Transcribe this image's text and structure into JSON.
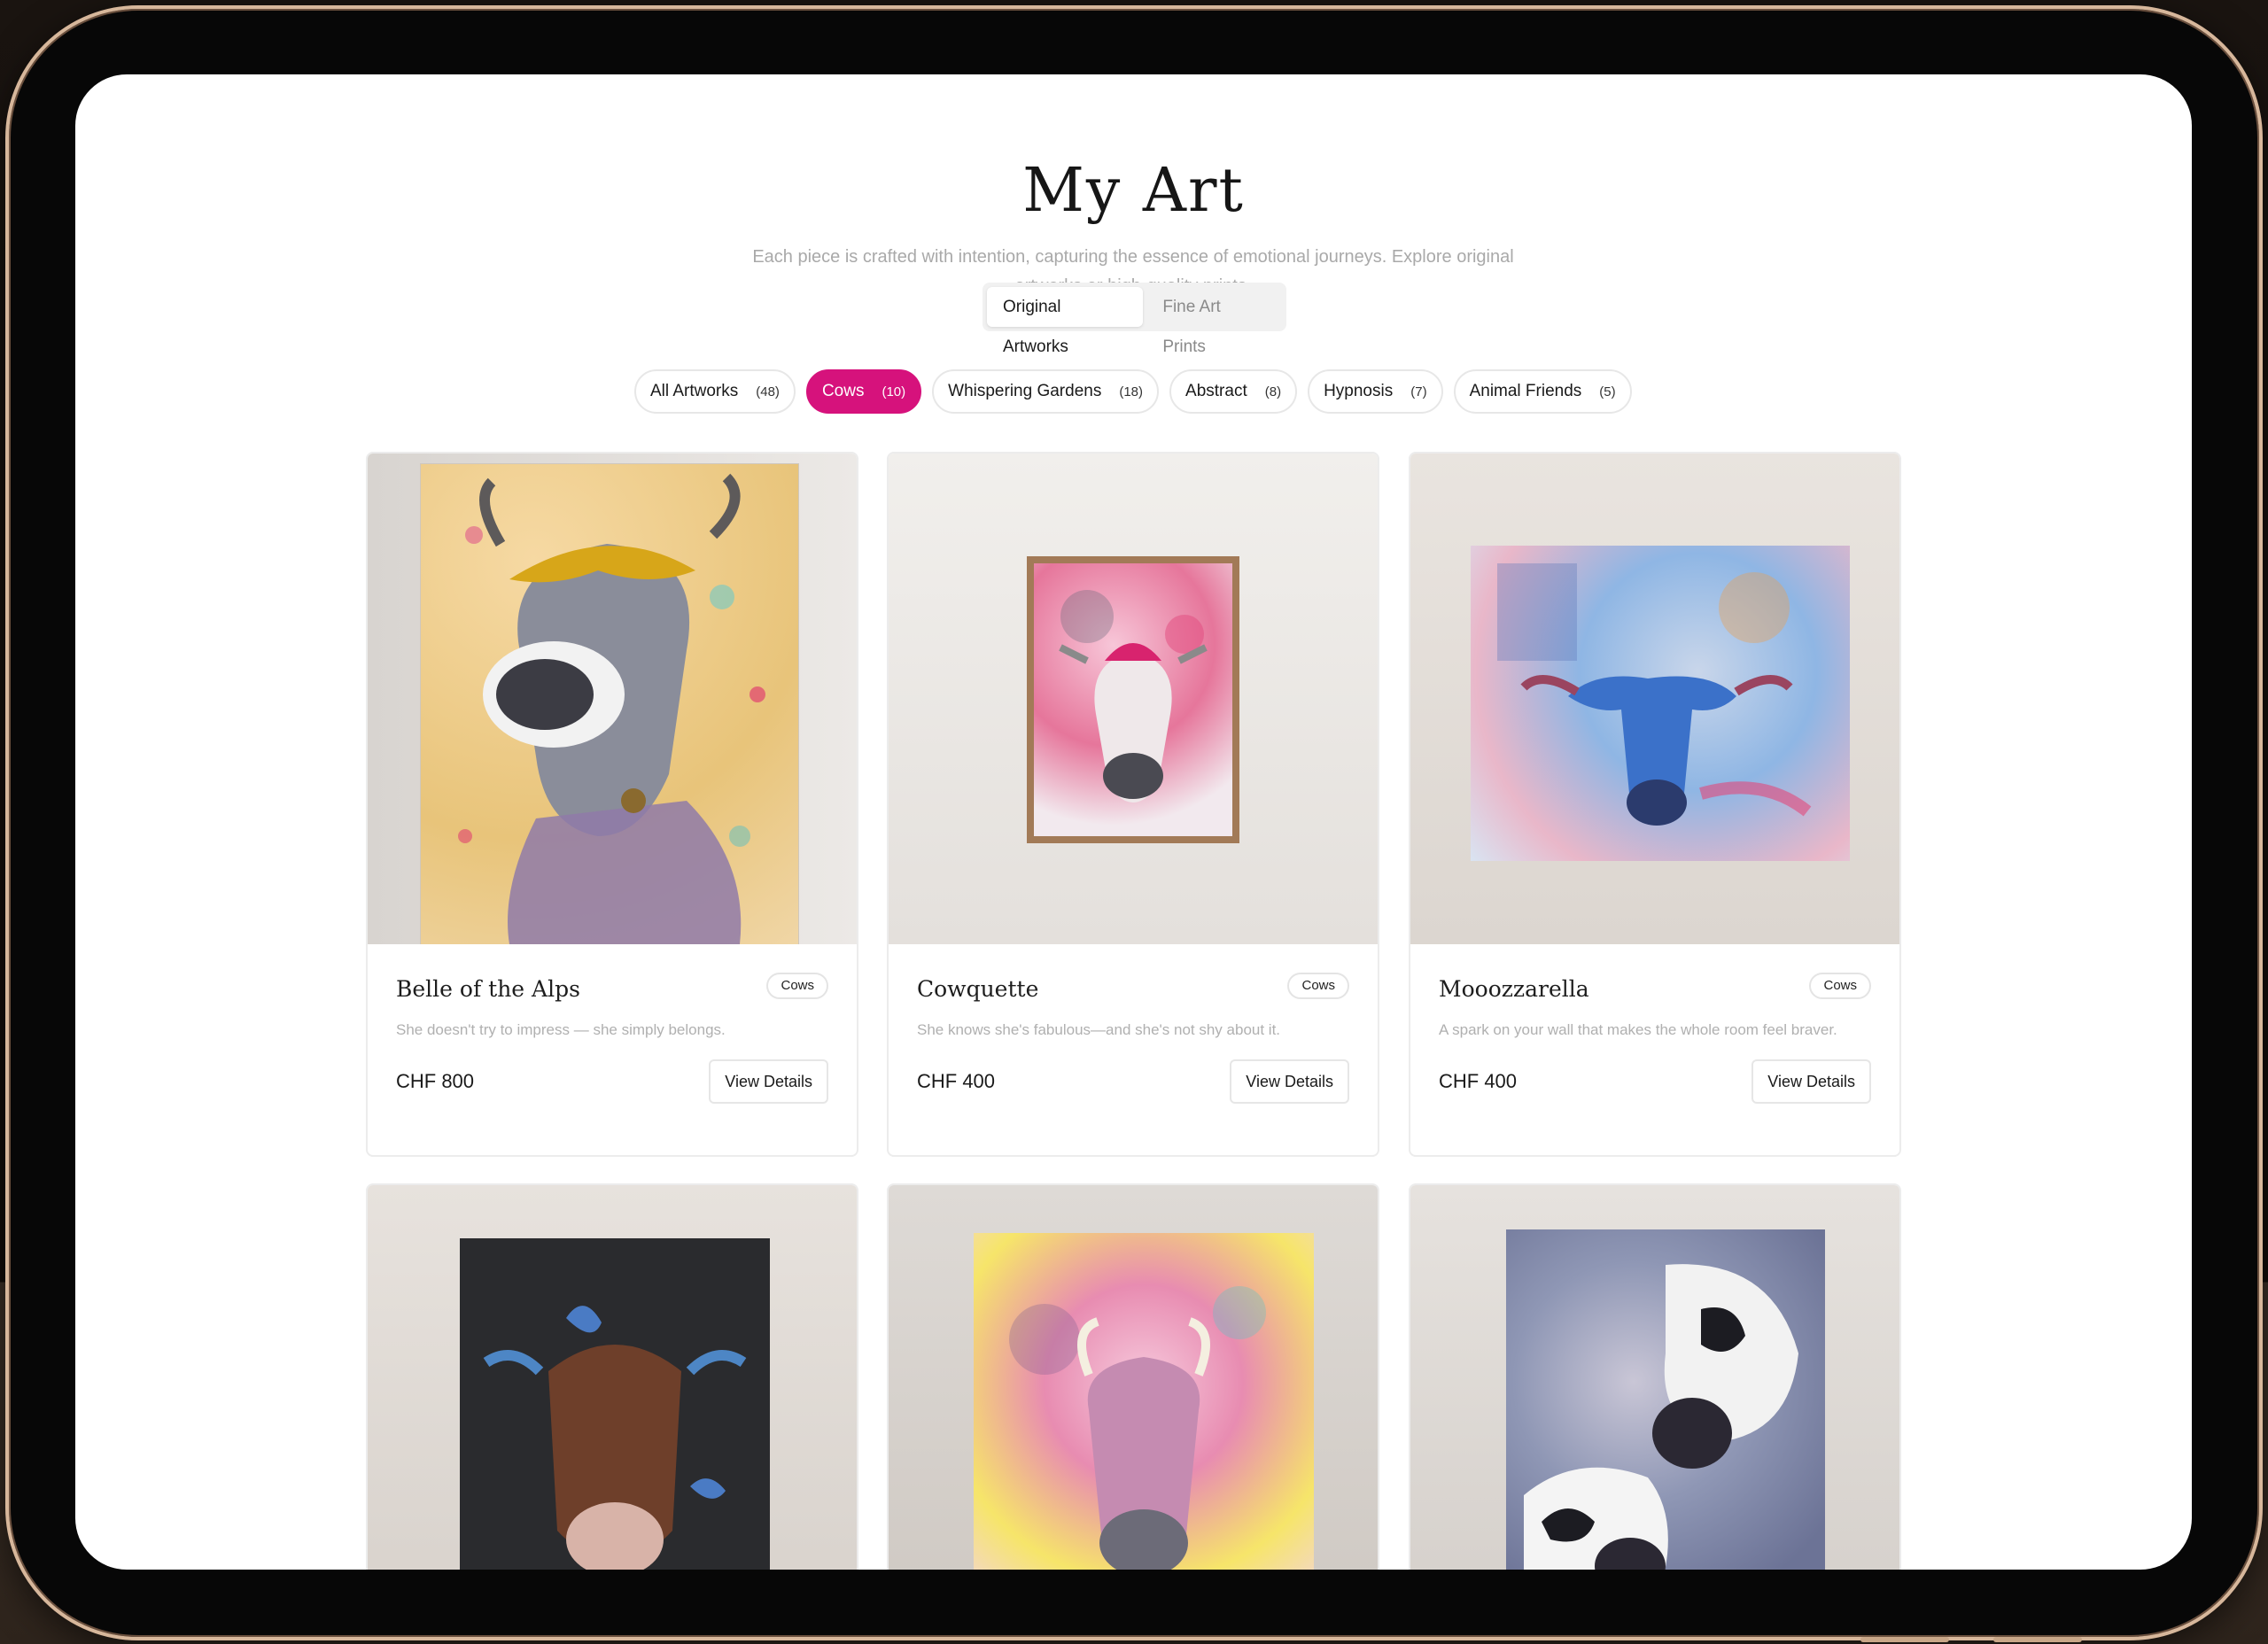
{
  "page": {
    "title": "My Art",
    "subtitle": "Each piece is crafted with intention, capturing the essence of emotional journeys. Explore original artworks or high-quality prints."
  },
  "toggle": {
    "options": [
      "Original Artworks",
      "Fine Art Prints"
    ],
    "selected": "Original Artworks"
  },
  "filters": [
    {
      "label": "All Artworks",
      "count": "(48)",
      "active": false
    },
    {
      "label": "Cows",
      "count": "(10)",
      "active": true
    },
    {
      "label": "Whispering Gardens",
      "count": "(18)",
      "active": false
    },
    {
      "label": "Abstract",
      "count": "(8)",
      "active": false
    },
    {
      "label": "Hypnosis",
      "count": "(7)",
      "active": false
    },
    {
      "label": "Animal Friends",
      "count": "(5)",
      "active": false
    }
  ],
  "artworks": [
    {
      "title": "Belle of the Alps",
      "tag": "Cows",
      "description": "She doesn't try to impress — she simply belongs.",
      "price": "CHF 800",
      "action": "View Details"
    },
    {
      "title": "Cowquette",
      "tag": "Cows",
      "description": "She knows she's fabulous—and she's not shy about it.",
      "price": "CHF 400",
      "action": "View Details"
    },
    {
      "title": "Mooozzarella",
      "tag": "Cows",
      "description": "A spark on your wall that makes the whole room feel braver.",
      "price": "CHF 400",
      "action": "View Details"
    }
  ],
  "colors": {
    "accent": "#d6127c",
    "device_frame": "#d7b79b"
  }
}
